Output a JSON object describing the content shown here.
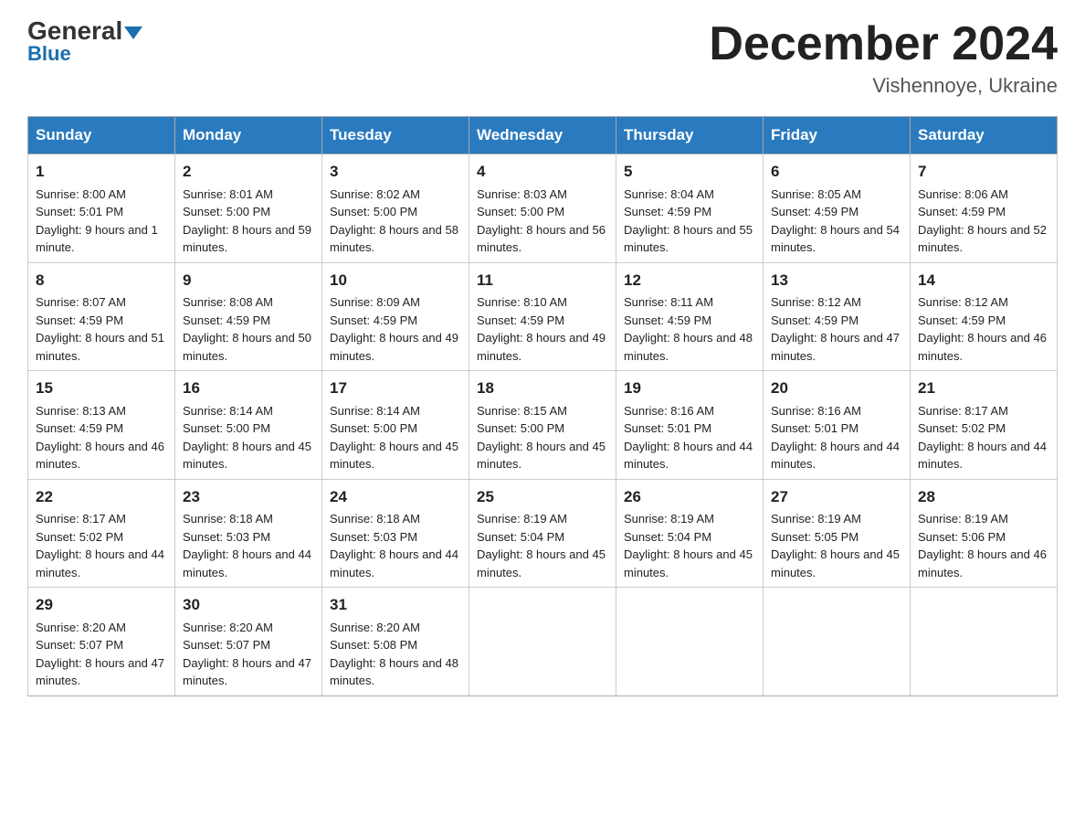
{
  "header": {
    "logo_line1": "General",
    "logo_line2": "Blue",
    "month_title": "December 2024",
    "location": "Vishennoye, Ukraine"
  },
  "weekdays": [
    "Sunday",
    "Monday",
    "Tuesday",
    "Wednesday",
    "Thursday",
    "Friday",
    "Saturday"
  ],
  "weeks": [
    [
      {
        "day": "1",
        "sunrise": "8:00 AM",
        "sunset": "5:01 PM",
        "daylight": "9 hours and 1 minute."
      },
      {
        "day": "2",
        "sunrise": "8:01 AM",
        "sunset": "5:00 PM",
        "daylight": "8 hours and 59 minutes."
      },
      {
        "day": "3",
        "sunrise": "8:02 AM",
        "sunset": "5:00 PM",
        "daylight": "8 hours and 58 minutes."
      },
      {
        "day": "4",
        "sunrise": "8:03 AM",
        "sunset": "5:00 PM",
        "daylight": "8 hours and 56 minutes."
      },
      {
        "day": "5",
        "sunrise": "8:04 AM",
        "sunset": "4:59 PM",
        "daylight": "8 hours and 55 minutes."
      },
      {
        "day": "6",
        "sunrise": "8:05 AM",
        "sunset": "4:59 PM",
        "daylight": "8 hours and 54 minutes."
      },
      {
        "day": "7",
        "sunrise": "8:06 AM",
        "sunset": "4:59 PM",
        "daylight": "8 hours and 52 minutes."
      }
    ],
    [
      {
        "day": "8",
        "sunrise": "8:07 AM",
        "sunset": "4:59 PM",
        "daylight": "8 hours and 51 minutes."
      },
      {
        "day": "9",
        "sunrise": "8:08 AM",
        "sunset": "4:59 PM",
        "daylight": "8 hours and 50 minutes."
      },
      {
        "day": "10",
        "sunrise": "8:09 AM",
        "sunset": "4:59 PM",
        "daylight": "8 hours and 49 minutes."
      },
      {
        "day": "11",
        "sunrise": "8:10 AM",
        "sunset": "4:59 PM",
        "daylight": "8 hours and 49 minutes."
      },
      {
        "day": "12",
        "sunrise": "8:11 AM",
        "sunset": "4:59 PM",
        "daylight": "8 hours and 48 minutes."
      },
      {
        "day": "13",
        "sunrise": "8:12 AM",
        "sunset": "4:59 PM",
        "daylight": "8 hours and 47 minutes."
      },
      {
        "day": "14",
        "sunrise": "8:12 AM",
        "sunset": "4:59 PM",
        "daylight": "8 hours and 46 minutes."
      }
    ],
    [
      {
        "day": "15",
        "sunrise": "8:13 AM",
        "sunset": "4:59 PM",
        "daylight": "8 hours and 46 minutes."
      },
      {
        "day": "16",
        "sunrise": "8:14 AM",
        "sunset": "5:00 PM",
        "daylight": "8 hours and 45 minutes."
      },
      {
        "day": "17",
        "sunrise": "8:14 AM",
        "sunset": "5:00 PM",
        "daylight": "8 hours and 45 minutes."
      },
      {
        "day": "18",
        "sunrise": "8:15 AM",
        "sunset": "5:00 PM",
        "daylight": "8 hours and 45 minutes."
      },
      {
        "day": "19",
        "sunrise": "8:16 AM",
        "sunset": "5:01 PM",
        "daylight": "8 hours and 44 minutes."
      },
      {
        "day": "20",
        "sunrise": "8:16 AM",
        "sunset": "5:01 PM",
        "daylight": "8 hours and 44 minutes."
      },
      {
        "day": "21",
        "sunrise": "8:17 AM",
        "sunset": "5:02 PM",
        "daylight": "8 hours and 44 minutes."
      }
    ],
    [
      {
        "day": "22",
        "sunrise": "8:17 AM",
        "sunset": "5:02 PM",
        "daylight": "8 hours and 44 minutes."
      },
      {
        "day": "23",
        "sunrise": "8:18 AM",
        "sunset": "5:03 PM",
        "daylight": "8 hours and 44 minutes."
      },
      {
        "day": "24",
        "sunrise": "8:18 AM",
        "sunset": "5:03 PM",
        "daylight": "8 hours and 44 minutes."
      },
      {
        "day": "25",
        "sunrise": "8:19 AM",
        "sunset": "5:04 PM",
        "daylight": "8 hours and 45 minutes."
      },
      {
        "day": "26",
        "sunrise": "8:19 AM",
        "sunset": "5:04 PM",
        "daylight": "8 hours and 45 minutes."
      },
      {
        "day": "27",
        "sunrise": "8:19 AM",
        "sunset": "5:05 PM",
        "daylight": "8 hours and 45 minutes."
      },
      {
        "day": "28",
        "sunrise": "8:19 AM",
        "sunset": "5:06 PM",
        "daylight": "8 hours and 46 minutes."
      }
    ],
    [
      {
        "day": "29",
        "sunrise": "8:20 AM",
        "sunset": "5:07 PM",
        "daylight": "8 hours and 47 minutes."
      },
      {
        "day": "30",
        "sunrise": "8:20 AM",
        "sunset": "5:07 PM",
        "daylight": "8 hours and 47 minutes."
      },
      {
        "day": "31",
        "sunrise": "8:20 AM",
        "sunset": "5:08 PM",
        "daylight": "8 hours and 48 minutes."
      },
      null,
      null,
      null,
      null
    ]
  ]
}
